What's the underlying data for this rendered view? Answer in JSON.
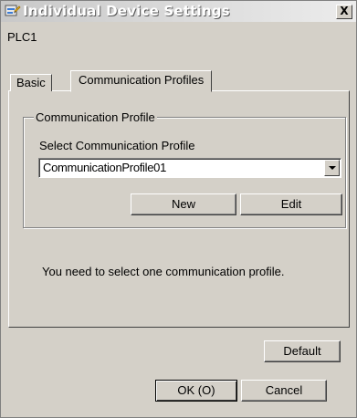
{
  "window": {
    "title": "Individual Device Settings",
    "close_label": "X",
    "icon": "settings-app-icon"
  },
  "device_name": "PLC1",
  "tabs": [
    {
      "label": "Basic",
      "selected": false
    },
    {
      "label": "Communication Profiles",
      "selected": true
    }
  ],
  "group": {
    "title": "Communication Profile",
    "select_label": "Select Communication Profile",
    "selected_profile": "CommunicationProfile01",
    "new_label": "New",
    "edit_label": "Edit"
  },
  "info_message": "You need to select one communication profile.",
  "buttons": {
    "default": "Default",
    "ok": "OK (O)",
    "cancel": "Cancel"
  }
}
